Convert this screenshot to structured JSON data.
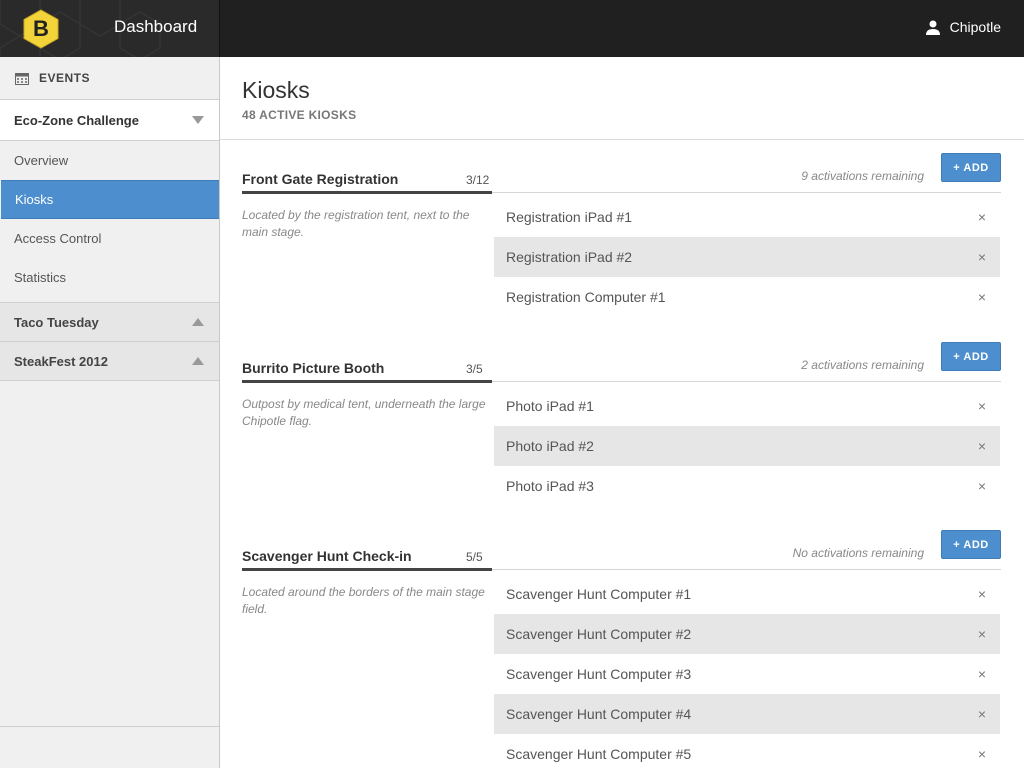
{
  "header": {
    "logo_letter": "B",
    "title": "Dashboard",
    "user_name": "Chipotle"
  },
  "sidebar": {
    "section_label": "EVENTS",
    "current_event": "Eco-Zone Challenge",
    "nav": [
      "Overview",
      "Kiosks",
      "Access Control",
      "Statistics"
    ],
    "active_nav": "Kiosks",
    "other_events": [
      "Taco Tuesday",
      "SteakFest 2012"
    ]
  },
  "main": {
    "title": "Kiosks",
    "subtitle": "48 ACTIVE KIOSKS",
    "add_label": "+ ADD",
    "groups": [
      {
        "name": "Front Gate Registration",
        "count": "3/12",
        "remaining": "9 activations remaining",
        "description": "Located by the registration tent, next to the main stage.",
        "kiosks": [
          "Registration iPad #1",
          "Registration iPad #2",
          "Registration Computer #1"
        ]
      },
      {
        "name": "Burrito Picture Booth",
        "count": "3/5",
        "remaining": "2 activations remaining",
        "description": "Outpost by medical tent, underneath the large Chipotle flag.",
        "kiosks": [
          "Photo iPad #1",
          "Photo iPad #2",
          "Photo iPad #3"
        ]
      },
      {
        "name": "Scavenger Hunt Check-in",
        "count": "5/5",
        "remaining": "No activations remaining",
        "description": "Located around the borders of the main stage field.",
        "kiosks": [
          "Scavenger Hunt Computer #1",
          "Scavenger Hunt Computer #2",
          "Scavenger Hunt Computer #3",
          "Scavenger Hunt Computer #4",
          "Scavenger Hunt Computer #5"
        ]
      }
    ],
    "remove_icon": "×"
  },
  "colors": {
    "accent": "#4d8fce",
    "logo": "#f3d33a",
    "topbar": "#202020"
  }
}
